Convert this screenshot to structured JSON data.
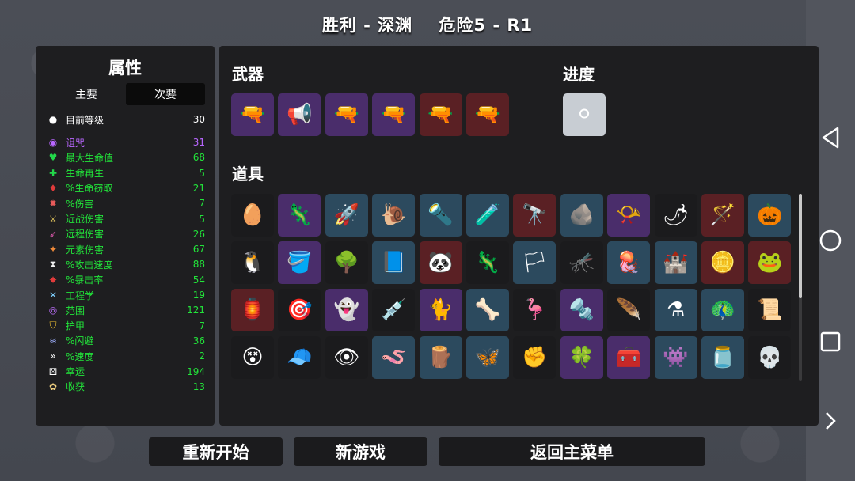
{
  "title": "胜利 - 深渊    危险5 - R1",
  "stats_panel": {
    "title": "属性",
    "tabs": [
      "主要",
      "次要"
    ],
    "level": {
      "icon": "level-up-icon",
      "label": "目前等级",
      "value": "30"
    },
    "stats": [
      {
        "icon": "curse-icon",
        "label": "诅咒",
        "value": "31",
        "color": "#b967ff"
      },
      {
        "icon": "heart-icon",
        "label": "最大生命值",
        "value": "68",
        "color": "#22e43a"
      },
      {
        "icon": "regen-icon",
        "label": "生命再生",
        "value": "5",
        "color": "#22e43a"
      },
      {
        "icon": "lifesteal-icon",
        "label": "%生命窃取",
        "value": "21",
        "color": "#22e43a"
      },
      {
        "icon": "damage-icon",
        "label": "%伤害",
        "value": "7",
        "color": "#22e43a"
      },
      {
        "icon": "sword-icon",
        "label": "近战伤害",
        "value": "5",
        "color": "#22e43a"
      },
      {
        "icon": "bow-icon",
        "label": "远程伤害",
        "value": "26",
        "color": "#22e43a"
      },
      {
        "icon": "fire-icon",
        "label": "元素伤害",
        "value": "67",
        "color": "#22e43a"
      },
      {
        "icon": "hourglass-icon",
        "label": "%攻击速度",
        "value": "88",
        "color": "#22e43a"
      },
      {
        "icon": "crit-icon",
        "label": "%暴击率",
        "value": "54",
        "color": "#22e43a"
      },
      {
        "icon": "wrench-icon",
        "label": "工程学",
        "value": "19",
        "color": "#22e43a"
      },
      {
        "icon": "range-icon",
        "label": "范围",
        "value": "121",
        "color": "#22e43a"
      },
      {
        "icon": "shield-icon",
        "label": "护甲",
        "value": "7",
        "color": "#22e43a"
      },
      {
        "icon": "dodge-icon",
        "label": "%闪避",
        "value": "36",
        "color": "#22e43a"
      },
      {
        "icon": "speed-icon",
        "label": "%速度",
        "value": "2",
        "color": "#22e43a"
      },
      {
        "icon": "dice-icon",
        "label": "幸运",
        "value": "194",
        "color": "#22e43a"
      },
      {
        "icon": "harvest-icon",
        "label": "收获",
        "value": "13",
        "color": "#22e43a"
      }
    ]
  },
  "weapons": {
    "label": "武器",
    "items": [
      {
        "icon": "laser-gun-icon",
        "tier": "purple",
        "glyph": "🔫"
      },
      {
        "icon": "blaster-icon",
        "tier": "purple",
        "glyph": "📢"
      },
      {
        "icon": "revolver-icon",
        "tier": "purple",
        "glyph": "🔫"
      },
      {
        "icon": "pistol-icon",
        "tier": "purple",
        "glyph": "🔫"
      },
      {
        "icon": "double-barrel-icon",
        "tier": "red",
        "glyph": "🔫"
      },
      {
        "icon": "shotgun-icon",
        "tier": "red",
        "glyph": "🔫"
      }
    ]
  },
  "progress": {
    "label": "进度",
    "item": {
      "icon": "pearl-icon",
      "tier": "gray",
      "glyph": "⚪"
    }
  },
  "items": {
    "label": "道具",
    "rows": [
      [
        {
          "icon": "egg-icon",
          "tier": "common",
          "glyph": "🥚"
        },
        {
          "icon": "creature-icon",
          "tier": "purple",
          "glyph": "🦎"
        },
        {
          "icon": "bullet-icon",
          "tier": "blue",
          "glyph": "🚀"
        },
        {
          "icon": "snail-icon",
          "tier": "blue",
          "glyph": "🐌"
        },
        {
          "icon": "flashlight-icon",
          "tier": "blue",
          "glyph": "🔦"
        },
        {
          "icon": "slime-icon",
          "tier": "blue",
          "glyph": "🧪"
        },
        {
          "icon": "binoculars-icon",
          "tier": "red",
          "glyph": "🔭"
        },
        {
          "icon": "coal-icon",
          "tier": "blue",
          "glyph": "🪨"
        },
        {
          "icon": "horn-icon",
          "tier": "purple",
          "glyph": "📯"
        },
        {
          "icon": "chili-icon",
          "tier": "common",
          "glyph": "🌶"
        },
        {
          "icon": "wand-icon",
          "tier": "red",
          "glyph": "🪄"
        },
        {
          "icon": "pumpkin-icon",
          "tier": "blue",
          "glyph": "🎃"
        }
      ],
      [
        {
          "icon": "penguin-icon",
          "tier": "common",
          "glyph": "🐧"
        },
        {
          "icon": "bucket-icon",
          "tier": "purple",
          "glyph": "🪣"
        },
        {
          "icon": "tree-icon",
          "tier": "common",
          "glyph": "🌳"
        },
        {
          "icon": "book-icon",
          "tier": "blue",
          "glyph": "📘"
        },
        {
          "icon": "panda-icon",
          "tier": "red",
          "glyph": "🐼"
        },
        {
          "icon": "lizard-icon",
          "tier": "common",
          "glyph": "🦎"
        },
        {
          "icon": "flag-icon",
          "tier": "blue",
          "glyph": "🏳"
        },
        {
          "icon": "mosquito-icon",
          "tier": "common",
          "glyph": "🦟"
        },
        {
          "icon": "jellyfish-icon",
          "tier": "blue",
          "glyph": "🪼"
        },
        {
          "icon": "castle-icon",
          "tier": "blue",
          "glyph": "🏰"
        },
        {
          "icon": "coin-icon",
          "tier": "red",
          "glyph": "🪙"
        },
        {
          "icon": "axolotl-icon",
          "tier": "red",
          "glyph": "🐸"
        }
      ],
      [
        {
          "icon": "lantern-icon",
          "tier": "red",
          "glyph": "🏮"
        },
        {
          "icon": "turret-icon",
          "tier": "common",
          "glyph": "🎯"
        },
        {
          "icon": "ghost-icon",
          "tier": "purple",
          "glyph": "👻"
        },
        {
          "icon": "syringe-icon",
          "tier": "common",
          "glyph": "💉"
        },
        {
          "icon": "cursed-cat-icon",
          "tier": "purple",
          "glyph": "🐈"
        },
        {
          "icon": "claw-icon",
          "tier": "blue",
          "glyph": "🦴"
        },
        {
          "icon": "flamingo-icon",
          "tier": "common",
          "glyph": "🦩"
        },
        {
          "icon": "scrap-icon",
          "tier": "purple",
          "glyph": "🔩"
        },
        {
          "icon": "feather-icon",
          "tier": "common",
          "glyph": "🪶"
        },
        {
          "icon": "potion-icon",
          "tier": "blue",
          "glyph": "⚗"
        },
        {
          "icon": "peacock-icon",
          "tier": "blue",
          "glyph": "🦚"
        },
        {
          "icon": "scroll-icon",
          "tier": "common",
          "glyph": "📜"
        }
      ],
      [
        {
          "icon": "mummy-icon",
          "tier": "common",
          "glyph": "😵"
        },
        {
          "icon": "beanie-icon",
          "tier": "common",
          "glyph": "🧢"
        },
        {
          "icon": "eyeball-icon",
          "tier": "common",
          "glyph": "👁"
        },
        {
          "icon": "worm-icon",
          "tier": "blue",
          "glyph": "🪱"
        },
        {
          "icon": "plank-icon",
          "tier": "blue",
          "glyph": "🪵"
        },
        {
          "icon": "butterfly-icon",
          "tier": "blue",
          "glyph": "🦋"
        },
        {
          "icon": "hand-icon",
          "tier": "common",
          "glyph": "✊"
        },
        {
          "icon": "clover-icon",
          "tier": "purple",
          "glyph": "🍀"
        },
        {
          "icon": "toolbox-icon",
          "tier": "purple",
          "glyph": "🧰"
        },
        {
          "icon": "alien-icon",
          "tier": "blue",
          "glyph": "👾"
        },
        {
          "icon": "jar-icon",
          "tier": "blue",
          "glyph": "🫙"
        },
        {
          "icon": "skull-icon",
          "tier": "common",
          "glyph": "💀"
        }
      ]
    ]
  },
  "buttons": {
    "restart": "重新开始",
    "new_game": "新游戏",
    "main_menu": "返回主菜单"
  },
  "nav": {
    "back_icon": "back-triangle-icon",
    "home_icon": "home-circle-icon",
    "recents_icon": "recents-square-icon",
    "expand_icon": "chevron-right-icon"
  }
}
